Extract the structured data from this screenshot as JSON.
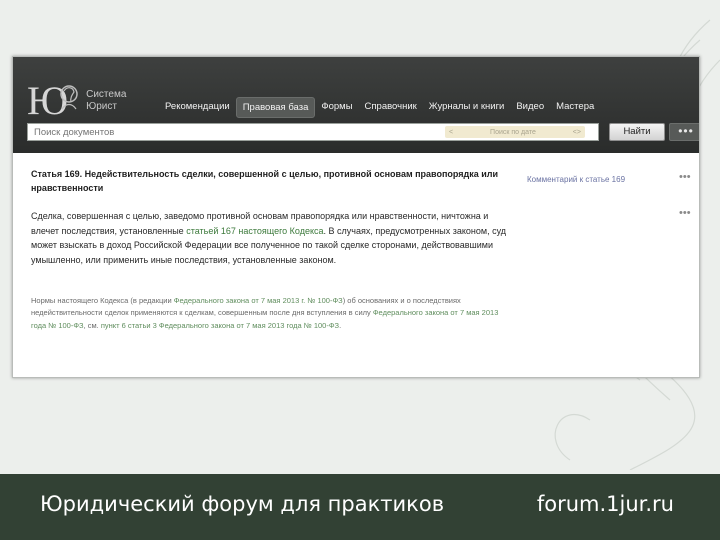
{
  "brand": {
    "logo_mark": "Ю",
    "line1": "Система",
    "line2": "Юрист"
  },
  "nav": [
    {
      "label": "Рекомендации",
      "active": false
    },
    {
      "label": "Правовая база",
      "active": true
    },
    {
      "label": "Формы",
      "active": false
    },
    {
      "label": "Справочник",
      "active": false
    },
    {
      "label": "Журналы и книги",
      "active": false
    },
    {
      "label": "Видео",
      "active": false
    },
    {
      "label": "Мастера",
      "active": false
    }
  ],
  "search": {
    "placeholder": "Поиск документов",
    "date_left": "<",
    "date_text": "Поиск по дате",
    "date_right": "<>",
    "button_label": "Найти",
    "more_label": "•••"
  },
  "article": {
    "title": "Статья 169. Недействительность сделки, совершенной с целью, противной основам правопорядка или нравственности",
    "side_link": "Комментарий к статье 169",
    "para1_a": "Сделка, совершенная с целью, заведомо противной основам правопорядка или нравственности, ничтожна и влечет последствия, установленные ",
    "para1_link": "статьей 167 настоящего Кодекса",
    "para1_b": ". В случаях, предусмотренных законом, суд может взыскать в доход Российской Федерации все полученное по такой сделке сторонами, действовавшими умышленно, или применить иные последствия, установленные законом.",
    "note_a": "Нормы настоящего Кодекса (в редакции ",
    "note_link1": "Федерального закона от 7 мая 2013 г. № 100-ФЗ",
    "note_b": ") об основаниях и о последствиях недействительности сделок применяются к сделкам, совершенным после дня вступления в силу ",
    "note_link2": "Федерального закона от 7 мая 2013 года № 100-ФЗ",
    "note_c": ", см. ",
    "note_link3": "пункт 6 статьи 3 Федерального закона от 7 мая 2013 года № 100-ФЗ",
    "note_d": ".",
    "dots": "•••"
  },
  "footer": {
    "title": "Юридический форум для практиков",
    "site": "forum.1jur.ru"
  },
  "colors": {
    "topbar": "#2f3130",
    "footer": "#324134",
    "link": "#3d7a3c"
  }
}
